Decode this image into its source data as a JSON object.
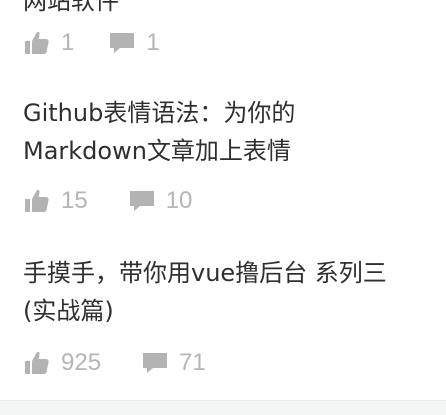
{
  "articles": [
    {
      "title_lines": [
        "网站软件"
      ],
      "likes": "1",
      "comments": "1"
    },
    {
      "title_lines": [
        "Github表情语法：为你的",
        "Markdown文章加上表情"
      ],
      "likes": "15",
      "comments": "10"
    },
    {
      "title_lines": [
        "手摸手，带你用vue撸后台 系列三",
        "(实战篇)"
      ],
      "likes": "925",
      "comments": "71"
    }
  ],
  "icons": {
    "like": "thumbs-up-icon",
    "comment": "comment-icon"
  },
  "colors": {
    "title": "#2f2f2f",
    "meta": "#b0b0b0",
    "icon": "#b3b3b3",
    "band": "#f4f5f5"
  }
}
